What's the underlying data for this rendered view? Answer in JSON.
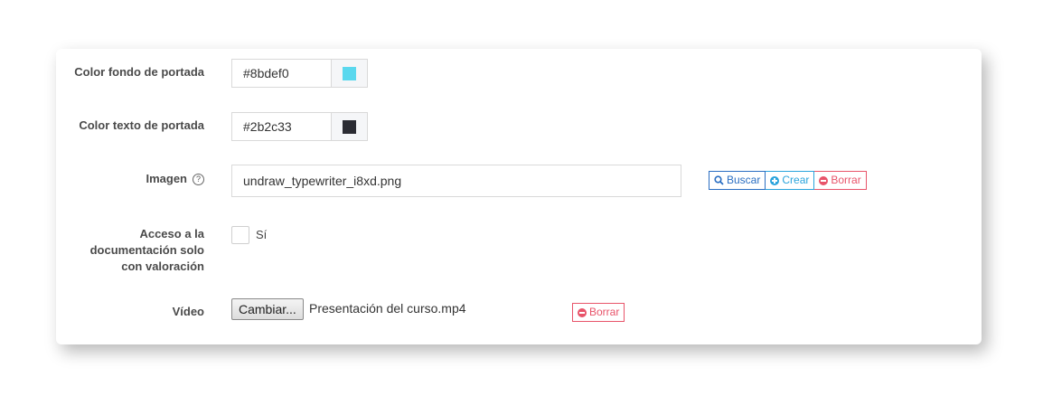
{
  "form": {
    "bg_color": {
      "label": "Color fondo de portada",
      "value": "#8bdef0",
      "swatch": "#5ad8ee"
    },
    "text_color": {
      "label": "Color texto de portada",
      "value": "#2b2c33",
      "swatch": "#2b2c33"
    },
    "image": {
      "label": "Imagen",
      "help_icon": "question-circle-icon",
      "value": "undraw_typewriter_i8xd.png",
      "buttons": {
        "search": "Buscar",
        "create": "Crear",
        "delete": "Borrar"
      }
    },
    "access": {
      "label_line1": "Acceso a la",
      "label_line2": "documentación solo",
      "label_line3": "con valoración",
      "checkbox_label": "Sí",
      "checked": false
    },
    "video": {
      "label": "Vídeo",
      "change_button": "Cambiar...",
      "file_name": "Presentación del curso.mp4",
      "delete": "Borrar"
    }
  },
  "colors": {
    "primary": "#2a6ec2",
    "info": "#2aa4dc",
    "danger": "#e8546a"
  }
}
